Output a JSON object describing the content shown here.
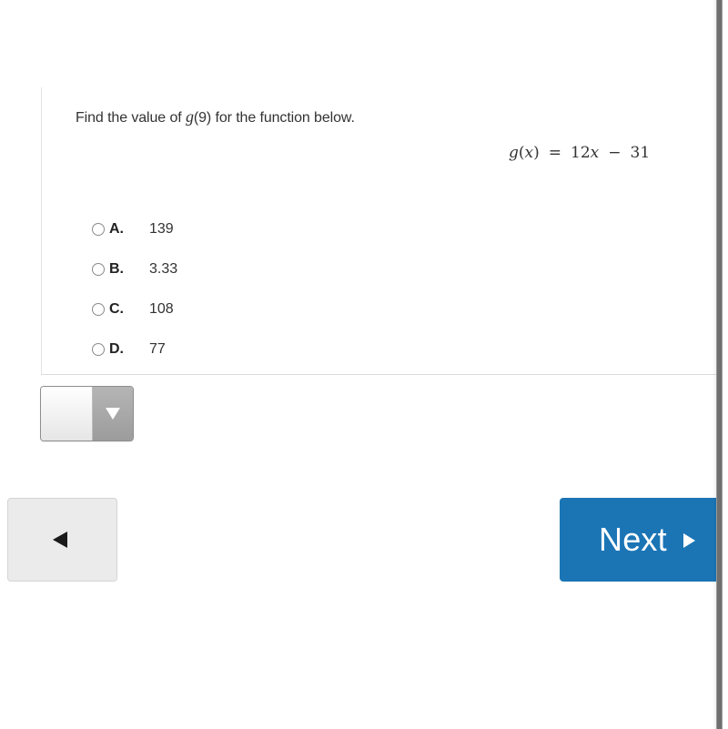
{
  "question": {
    "prompt_before": "Find the value of ",
    "prompt_func": "g",
    "prompt_arg": "(9)",
    "prompt_after": " for the function below.",
    "equation": {
      "lhs_func": "g",
      "lhs_open": "(",
      "lhs_var": "x",
      "lhs_close": ")",
      "equals": "=",
      "coef": "12",
      "var": "x",
      "minus": "−",
      "constant": "31"
    }
  },
  "choices": [
    {
      "letter": "A.",
      "value": "139",
      "selected": false
    },
    {
      "letter": "B.",
      "value": "3.33",
      "selected": false
    },
    {
      "letter": "C.",
      "value": "108",
      "selected": false
    },
    {
      "letter": "D.",
      "value": "77",
      "selected": false
    }
  ],
  "answer_select": {
    "value": "",
    "icon": "triangle-down-icon"
  },
  "navigation": {
    "back_icon": "triangle-left-icon",
    "next_label": "Next",
    "next_icon": "triangle-right-icon"
  },
  "colors": {
    "next_button": "#1b75b5",
    "back_button": "#ebebeb",
    "text": "#333333"
  }
}
